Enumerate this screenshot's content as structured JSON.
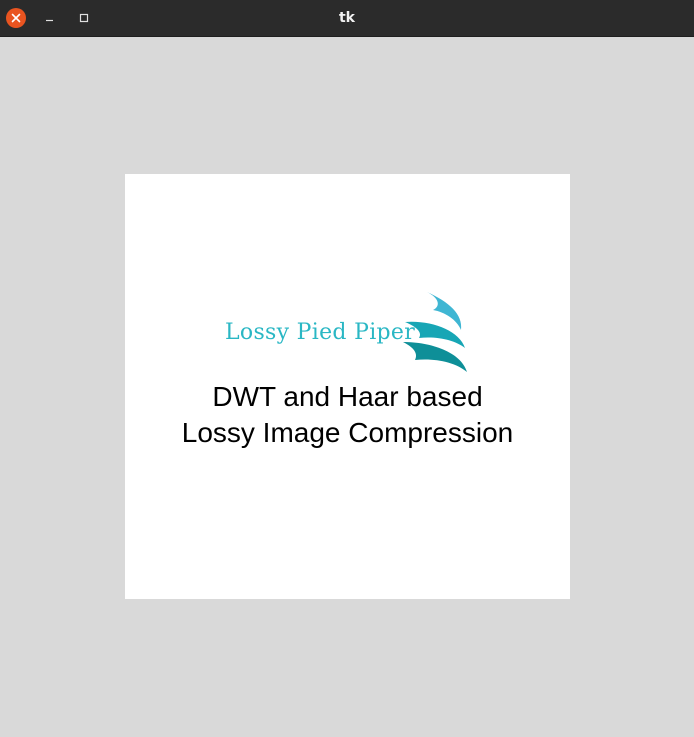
{
  "window": {
    "title": "tk"
  },
  "canvas": {
    "logo": {
      "brand_text": "Lossy Pied Piper",
      "icon": "wave-swoosh-icon"
    },
    "headline": {
      "line1": "DWT and Haar based",
      "line2": "Lossy Image Compression"
    }
  },
  "colors": {
    "titlebar": "#2b2b2b",
    "close_button": "#e95420",
    "window_background": "#d9d9d9",
    "canvas_background": "#ffffff",
    "logo_teal": "#2ab7c4",
    "logo_dark_teal": "#0e8f98"
  }
}
